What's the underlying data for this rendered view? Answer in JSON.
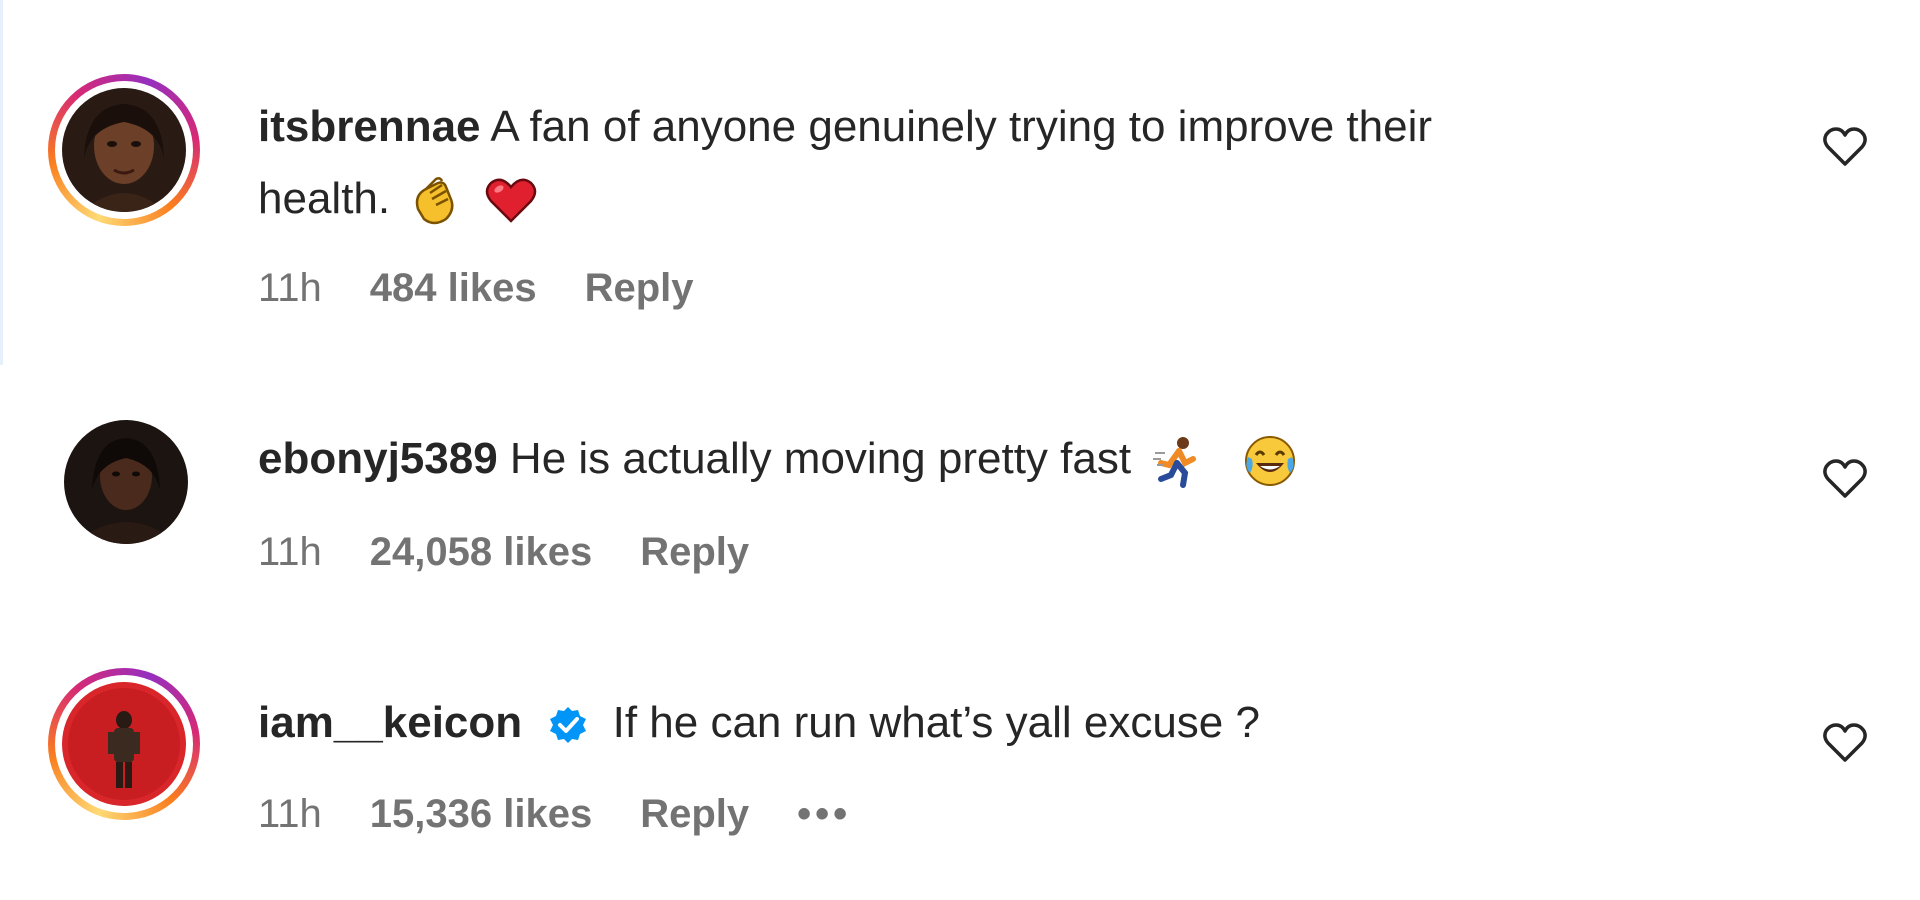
{
  "comments": [
    {
      "username": "itsbrennae",
      "text_line1": "A fan of anyone genuinely trying to improve their",
      "text_line2": "health.",
      "emojis": [
        "clapping-hands-emoji",
        "red-heart-emoji"
      ],
      "time": "11h",
      "likes": "484 likes",
      "reply": "Reply",
      "has_story_ring": true,
      "verified": false
    },
    {
      "username": "ebonyj5389",
      "text_line1": "He is actually moving pretty fast",
      "emojis": [
        "person-running-emoji",
        "face-with-tears-of-joy-emoji"
      ],
      "time": "11h",
      "likes": "24,058 likes",
      "reply": "Reply",
      "has_story_ring": false,
      "verified": false
    },
    {
      "username": "iam__keicon",
      "text_line1": "If he can run what’s yall excuse ?",
      "emojis": [],
      "time": "11h",
      "likes": "15,336 likes",
      "reply": "Reply",
      "more": "•••",
      "has_story_ring": true,
      "verified": true
    }
  ],
  "colors": {
    "text": "#262626",
    "meta": "#737373",
    "verified": "#0095f6",
    "heart_outline": "#262626"
  },
  "icons": {
    "like": "heart-outline-icon",
    "verified": "verified-badge-icon",
    "more": "more-options-icon"
  }
}
